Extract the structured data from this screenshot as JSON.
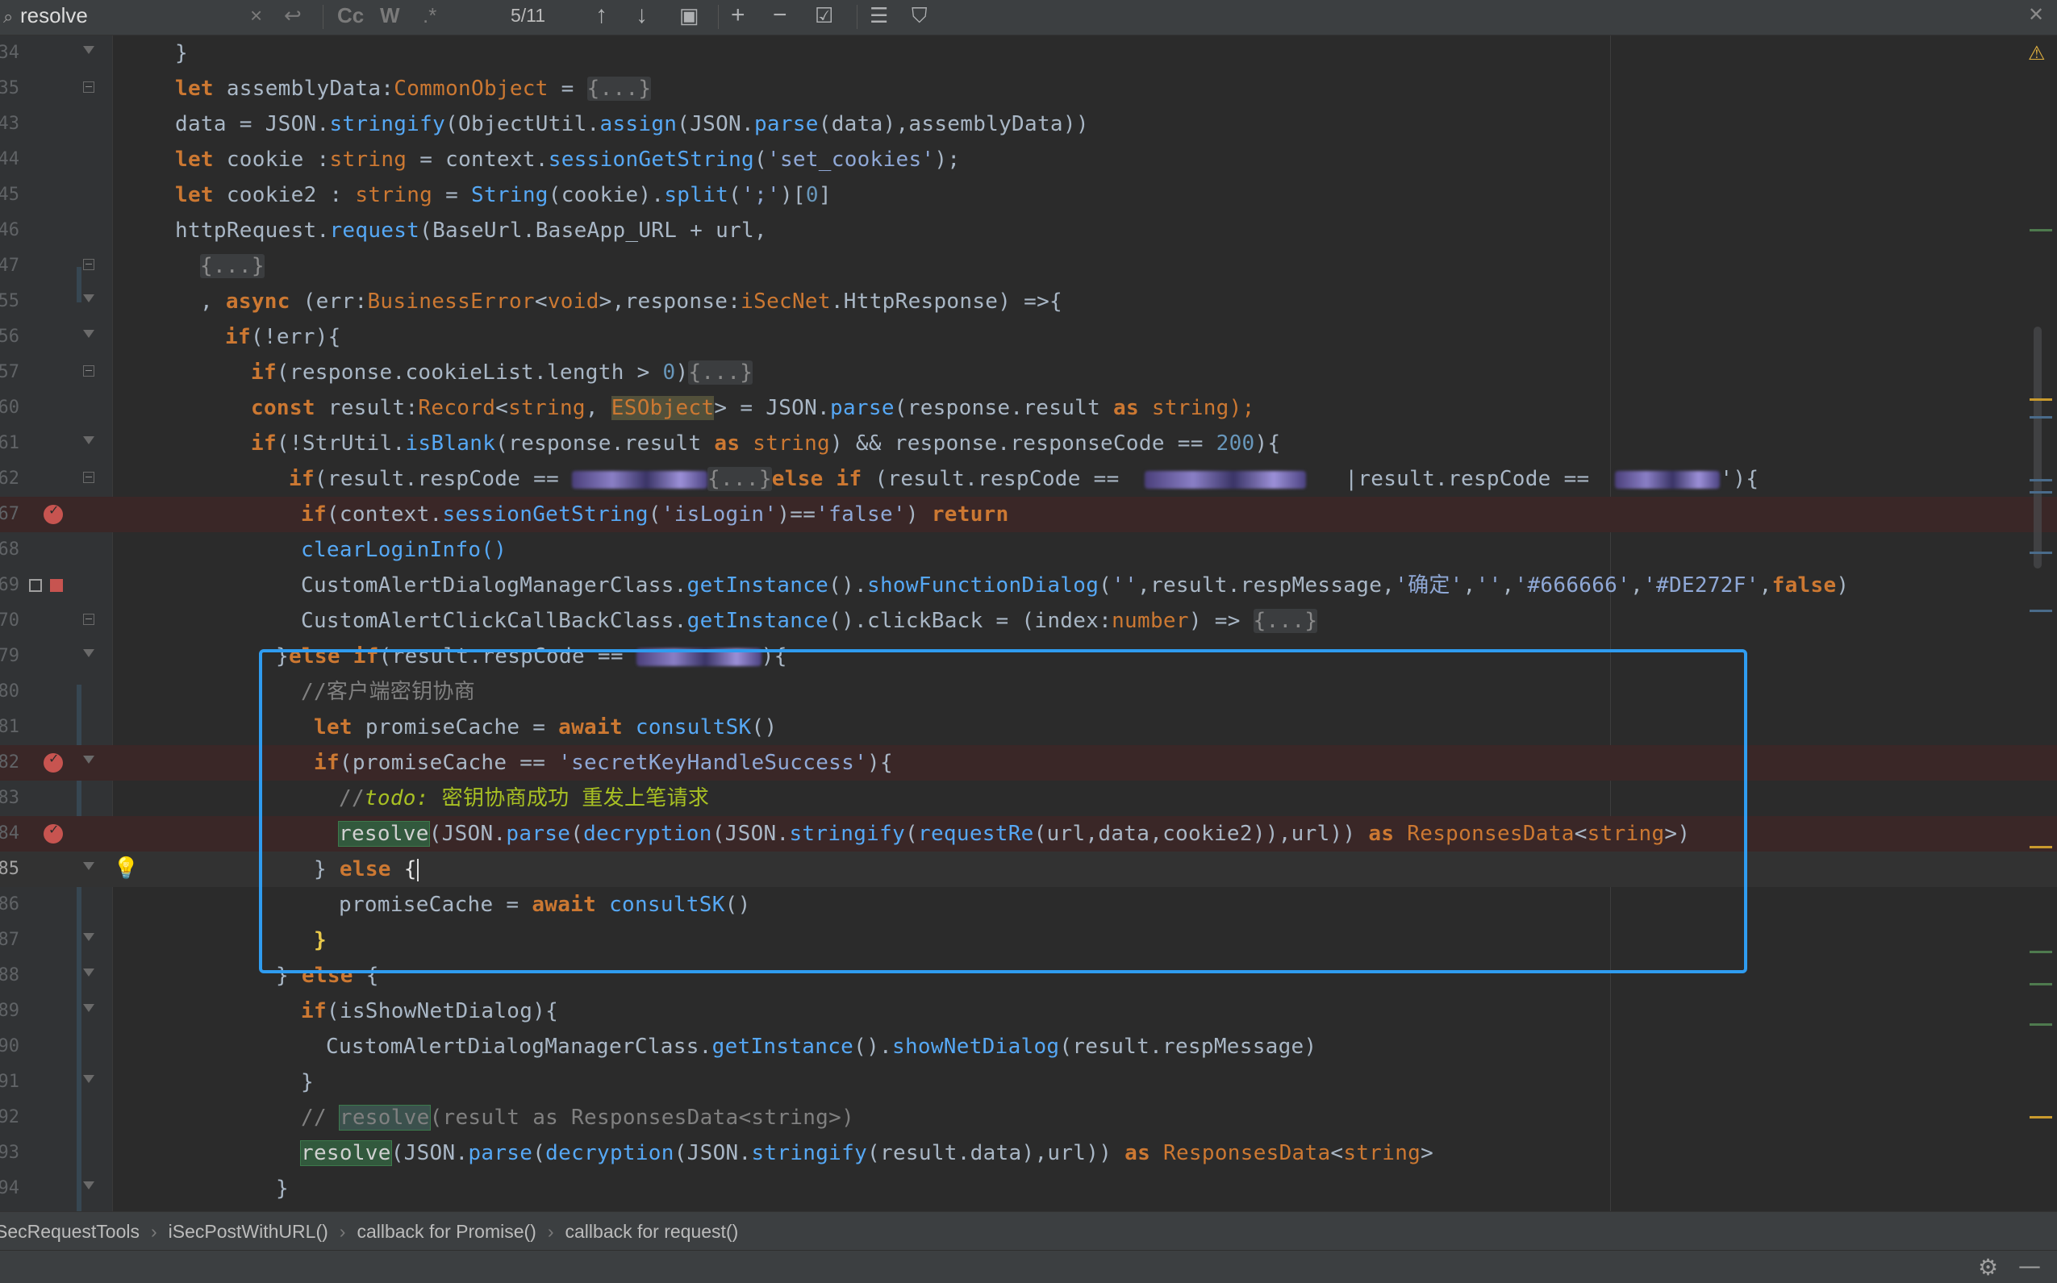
{
  "findbar": {
    "query": "resolve",
    "count": "5/11",
    "match_case_label": "Cc",
    "words_label": "W",
    "regex_label": ".*"
  },
  "lines": [
    {
      "no": "34"
    },
    {
      "no": "35"
    },
    {
      "no": "43"
    },
    {
      "no": "44"
    },
    {
      "no": "45"
    },
    {
      "no": "46"
    },
    {
      "no": "47"
    },
    {
      "no": "55"
    },
    {
      "no": "56"
    },
    {
      "no": "57"
    },
    {
      "no": "60"
    },
    {
      "no": "61"
    },
    {
      "no": "62"
    },
    {
      "no": "67"
    },
    {
      "no": "68"
    },
    {
      "no": "69"
    },
    {
      "no": "70"
    },
    {
      "no": "79"
    },
    {
      "no": "80"
    },
    {
      "no": "81"
    },
    {
      "no": "82"
    },
    {
      "no": "83"
    },
    {
      "no": "84"
    },
    {
      "no": "85"
    },
    {
      "no": "86"
    },
    {
      "no": "87"
    },
    {
      "no": "88"
    },
    {
      "no": "89"
    },
    {
      "no": "90"
    },
    {
      "no": "91"
    },
    {
      "no": "92"
    },
    {
      "no": "93"
    },
    {
      "no": "94"
    }
  ],
  "code": {
    "l35_var": "assemblyData",
    "l35_type": "CommonObject",
    "fold_obj": "{...}",
    "l43": {
      "a": "data = JSON.",
      "m1": "stringify",
      "b": "(ObjectUtil.",
      "m2": "assign",
      "c": "(JSON.",
      "m3": "parse",
      "d": "(data),assemblyData))"
    },
    "l44": {
      "var": "cookie",
      "type": "string",
      "ctx": "context.",
      "m": "sessionGetString",
      "s": "'set_cookies'",
      "end": ");"
    },
    "l45": {
      "var": "cookie2",
      "type": "string",
      "cls": "String",
      "a": "(cookie).",
      "m": "split",
      "s": "';'",
      "n": "0"
    },
    "l46": {
      "a": "httpRequest.",
      "m": "request",
      "b": "(BaseUrl.BaseApp_URL + url,"
    },
    "l55": {
      "a": "(err:",
      "t1": "BusinessError",
      "t2": "void",
      "b": ">,response:",
      "t3": "iSecNet",
      "c": ".HttpResponse) =>{"
    },
    "l56": "(!err){",
    "l57": {
      "a": "(response.cookieList.length > ",
      "n": "0",
      "b": ")"
    },
    "l60": {
      "a": " result:",
      "t": "Record",
      "t2": "string",
      "eso": "ESObject",
      "b": "> = JSON.",
      "m": "parse",
      "c": "(response.result ",
      "d": " string);"
    },
    "l61": {
      "a": "(!StrUtil.",
      "m": "isBlank",
      "b": "(response.result ",
      "t": "string",
      "c": ") && response.responseCode == ",
      "n": "200",
      "d": "){"
    },
    "l62": {
      "a": "(result.respCode == ",
      "b": "(result.respCode == ",
      "c": "|result.respCode == ",
      "d": "'){"
    },
    "l67": {
      "a": "(context.",
      "m": "sessionGetString",
      "s": "'isLogin'",
      "b": ")==",
      "s2": "'false'",
      "c": ") "
    },
    "l68": "clearLoginInfo()",
    "l69": {
      "a": "CustomAlertDialogManagerClass.",
      "m1": "getInstance",
      "b": "().",
      "m2": "showFunctionDialog",
      "s1": "''",
      "c": ",result.respMessage,",
      "s2": "'确定'",
      "s3": "''",
      "s4": "'#666666'",
      "s5": "'#DE272F'"
    },
    "l70": {
      "a": "CustomAlertClickCallBackClass.",
      "m1": "getInstance",
      "b": "().clickBack = (index:",
      "t": "number",
      "c": ") => "
    },
    "l79": {
      "a": "(result.respCode == ",
      "b": "){"
    },
    "l80": "//客户端密钥协商",
    "l81": {
      "var": " promiseCache = ",
      "m": "consultSK",
      "end": "()"
    },
    "l82": {
      "a": "(promiseCache == ",
      "s": "'secretKeyHandleSuccess'",
      "b": "){"
    },
    "l83": {
      "a": "//",
      "todo": "todo:",
      "b": " 密钥协商成功 重发上笔请求"
    },
    "l84": {
      "r": "resolve",
      "a": "(JSON.",
      "m1": "parse",
      "b": "(",
      "m2": "decryption",
      "c": "(JSON.",
      "m3": "stringify",
      "d": "(",
      "m4": "requestRe",
      "e": "(url,data,cookie2)),url)) ",
      "t": "ResponsesData",
      "t2": "string"
    },
    "l85": "} else {",
    "l86": {
      "a": "promiseCache = ",
      "m": "consultSK",
      "end": "()"
    },
    "l87": "}",
    "l88": "} else {",
    "l89": {
      "a": "(isShowNetDialog){"
    },
    "l90": {
      "a": "CustomAlertDialogManagerClass.",
      "m1": "getInstance",
      "b": "().",
      "m2": "showNetDialog",
      "c": "(result.respMessage)"
    },
    "l91": "}",
    "l92": {
      "a": "// ",
      "r": "resolve",
      "b": "(result as ResponsesData<string>)"
    },
    "l93": {
      "r": "resolve",
      "a": "(JSON.",
      "m1": "parse",
      "b": "(",
      "m2": "decryption",
      "c": "(JSON.",
      "m3": "stringify",
      "d": "(result.data),url)) ",
      "t": "ResponsesData",
      "t2": "string"
    },
    "l94": "}"
  },
  "breadcrumb": [
    "SecRequestTools",
    "iSecPostWithURL()",
    "callback for Promise()",
    "callback for request()"
  ],
  "colors": {
    "accent": "#2f9cf0",
    "breakpoint": "#c75450",
    "background": "#2b2b2b"
  },
  "icons": [
    "search-icon",
    "clear-icon",
    "replace-icon",
    "arrow-up-icon",
    "arrow-down-icon",
    "open-in-window-icon",
    "add-occurrence-icon",
    "remove-occurrence-icon",
    "select-all-icon",
    "filter-icon",
    "close-icon",
    "warning-icon",
    "settings-icon",
    "minimize-icon",
    "breakpoint-icon",
    "bulb-icon"
  ]
}
